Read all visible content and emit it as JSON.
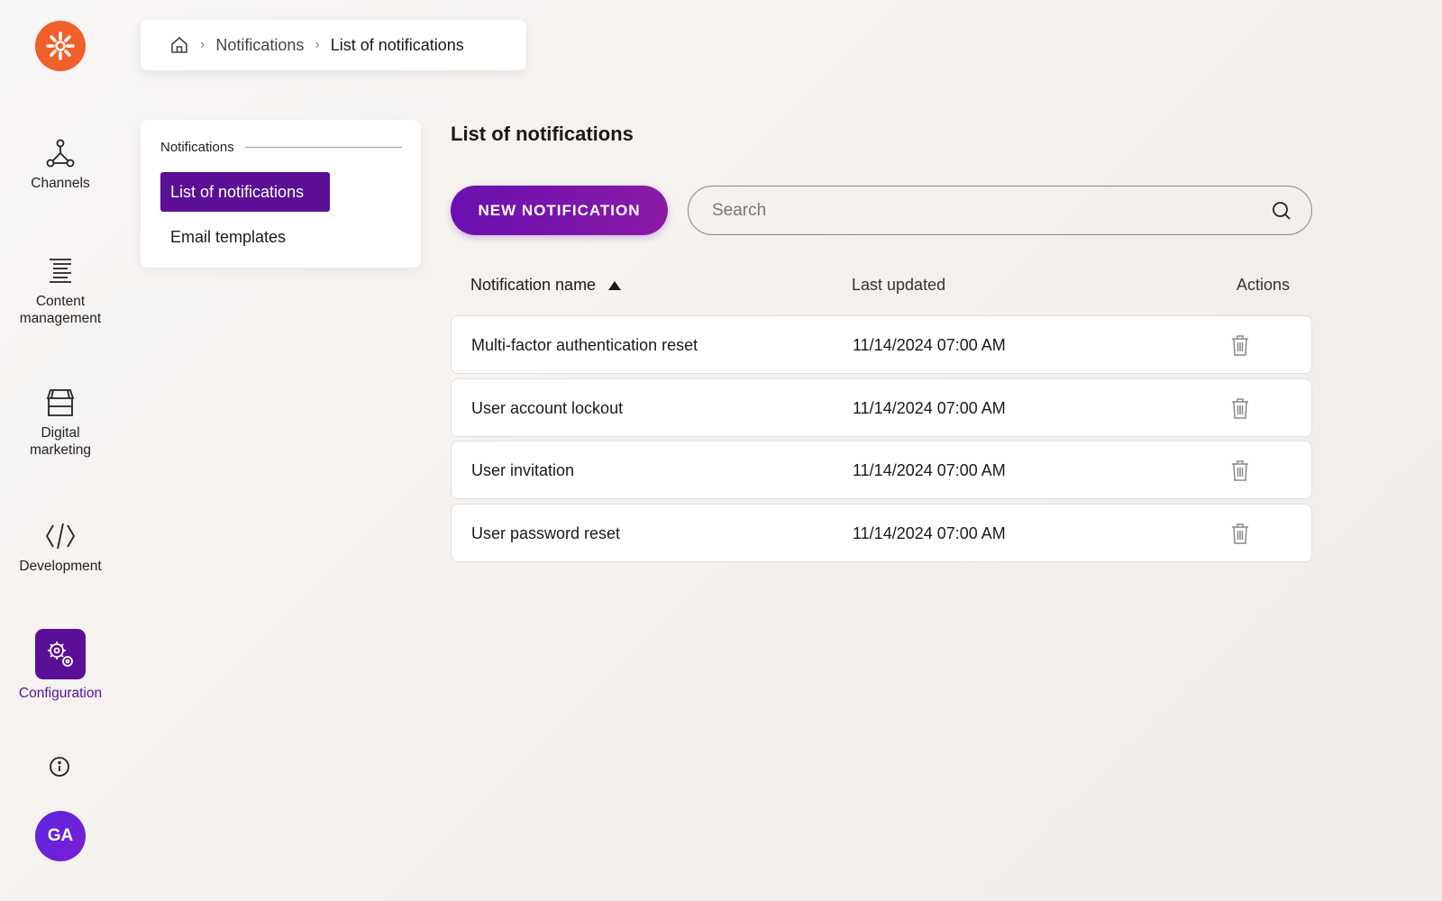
{
  "brand": {
    "accent": "#5a0f96",
    "logo_color": "#f0602a"
  },
  "rail": {
    "items": [
      {
        "label": "Channels",
        "icon": "channels-icon"
      },
      {
        "label_line1": "Content",
        "label_line2": "management",
        "icon": "content-icon"
      },
      {
        "label_line1": "Digital",
        "label_line2": "marketing",
        "icon": "store-icon"
      },
      {
        "label": "Development",
        "icon": "code-icon"
      },
      {
        "label": "Configuration",
        "icon": "gear-icon",
        "active": true
      }
    ],
    "avatar_initials": "GA"
  },
  "breadcrumb": {
    "items": [
      "Notifications",
      "List of notifications"
    ]
  },
  "submenu": {
    "section": "Notifications",
    "items": [
      "List of notifications",
      "Email templates"
    ]
  },
  "main": {
    "title": "List of notifications",
    "new_button": "NEW NOTIFICATION",
    "search_placeholder": "Search",
    "columns": [
      "Notification name",
      "Last updated",
      "Actions"
    ],
    "rows": [
      {
        "name": "Multi-factor authentication reset",
        "updated": "11/14/2024 07:00 AM"
      },
      {
        "name": "User account lockout",
        "updated": "11/14/2024 07:00 AM"
      },
      {
        "name": "User invitation",
        "updated": "11/14/2024 07:00 AM"
      },
      {
        "name": "User password reset",
        "updated": "11/14/2024 07:00 AM"
      }
    ]
  }
}
